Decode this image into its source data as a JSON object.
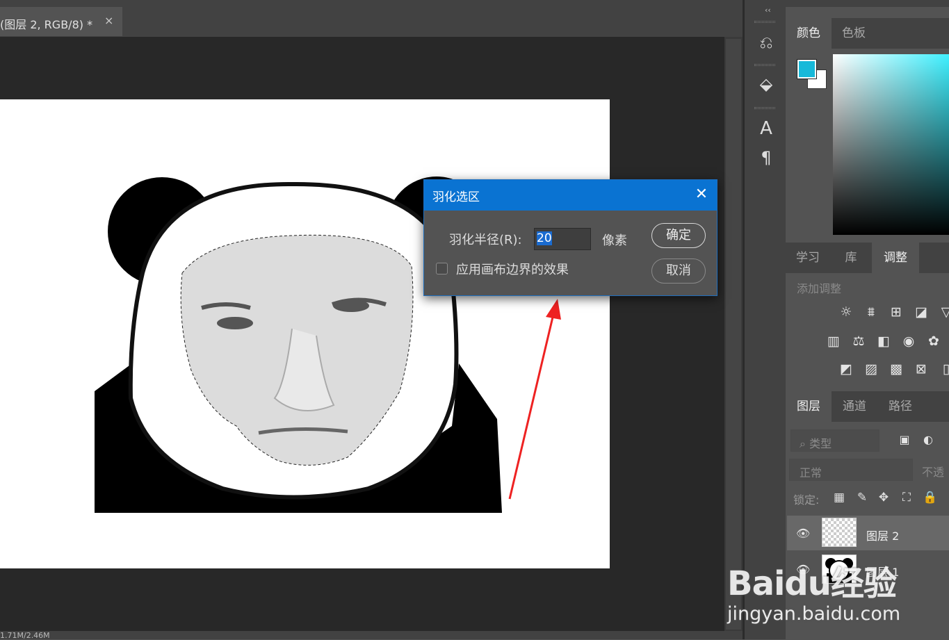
{
  "document": {
    "tab_title": "(图层 2, RGB/8) *",
    "tab_close": "×",
    "status_text": "1.71M/2.46M"
  },
  "dialog": {
    "title": "羽化选区",
    "close_glyph": "✕",
    "radius_label": "羽化半径(R):",
    "radius_value": "20",
    "unit": "像素",
    "apply_canvas_label": "应用画布边界的效果",
    "apply_canvas_checked": false,
    "ok_label": "确定",
    "cancel_label": "取消"
  },
  "toolstrip": {
    "collapse_glyph": "‹‹",
    "tools": [
      "history-icon",
      "3d-icon",
      "character-icon",
      "paragraph-icon"
    ]
  },
  "color_panel": {
    "tabs": [
      "颜色",
      "色板"
    ],
    "active_tab": "颜色",
    "foreground": "#17b9d9",
    "background": "#ffffff"
  },
  "adjust_panel": {
    "tabs": [
      "学习",
      "库",
      "调整"
    ],
    "active_tab": "调整",
    "hint": "添加调整"
  },
  "layers_panel": {
    "tabs": [
      "图层",
      "通道",
      "路径"
    ],
    "active_tab": "图层",
    "filter_placeholder": "类型",
    "blend_mode": "正常",
    "opacity_label": "不透",
    "lock_label": "锁定:",
    "layers": [
      {
        "name": "图层 2",
        "visible": true,
        "selected": true
      },
      {
        "name": "图层 1",
        "visible": true,
        "selected": false
      }
    ]
  },
  "watermark": {
    "brand": "Baidu经验",
    "url": "jingyan.baidu.com"
  }
}
